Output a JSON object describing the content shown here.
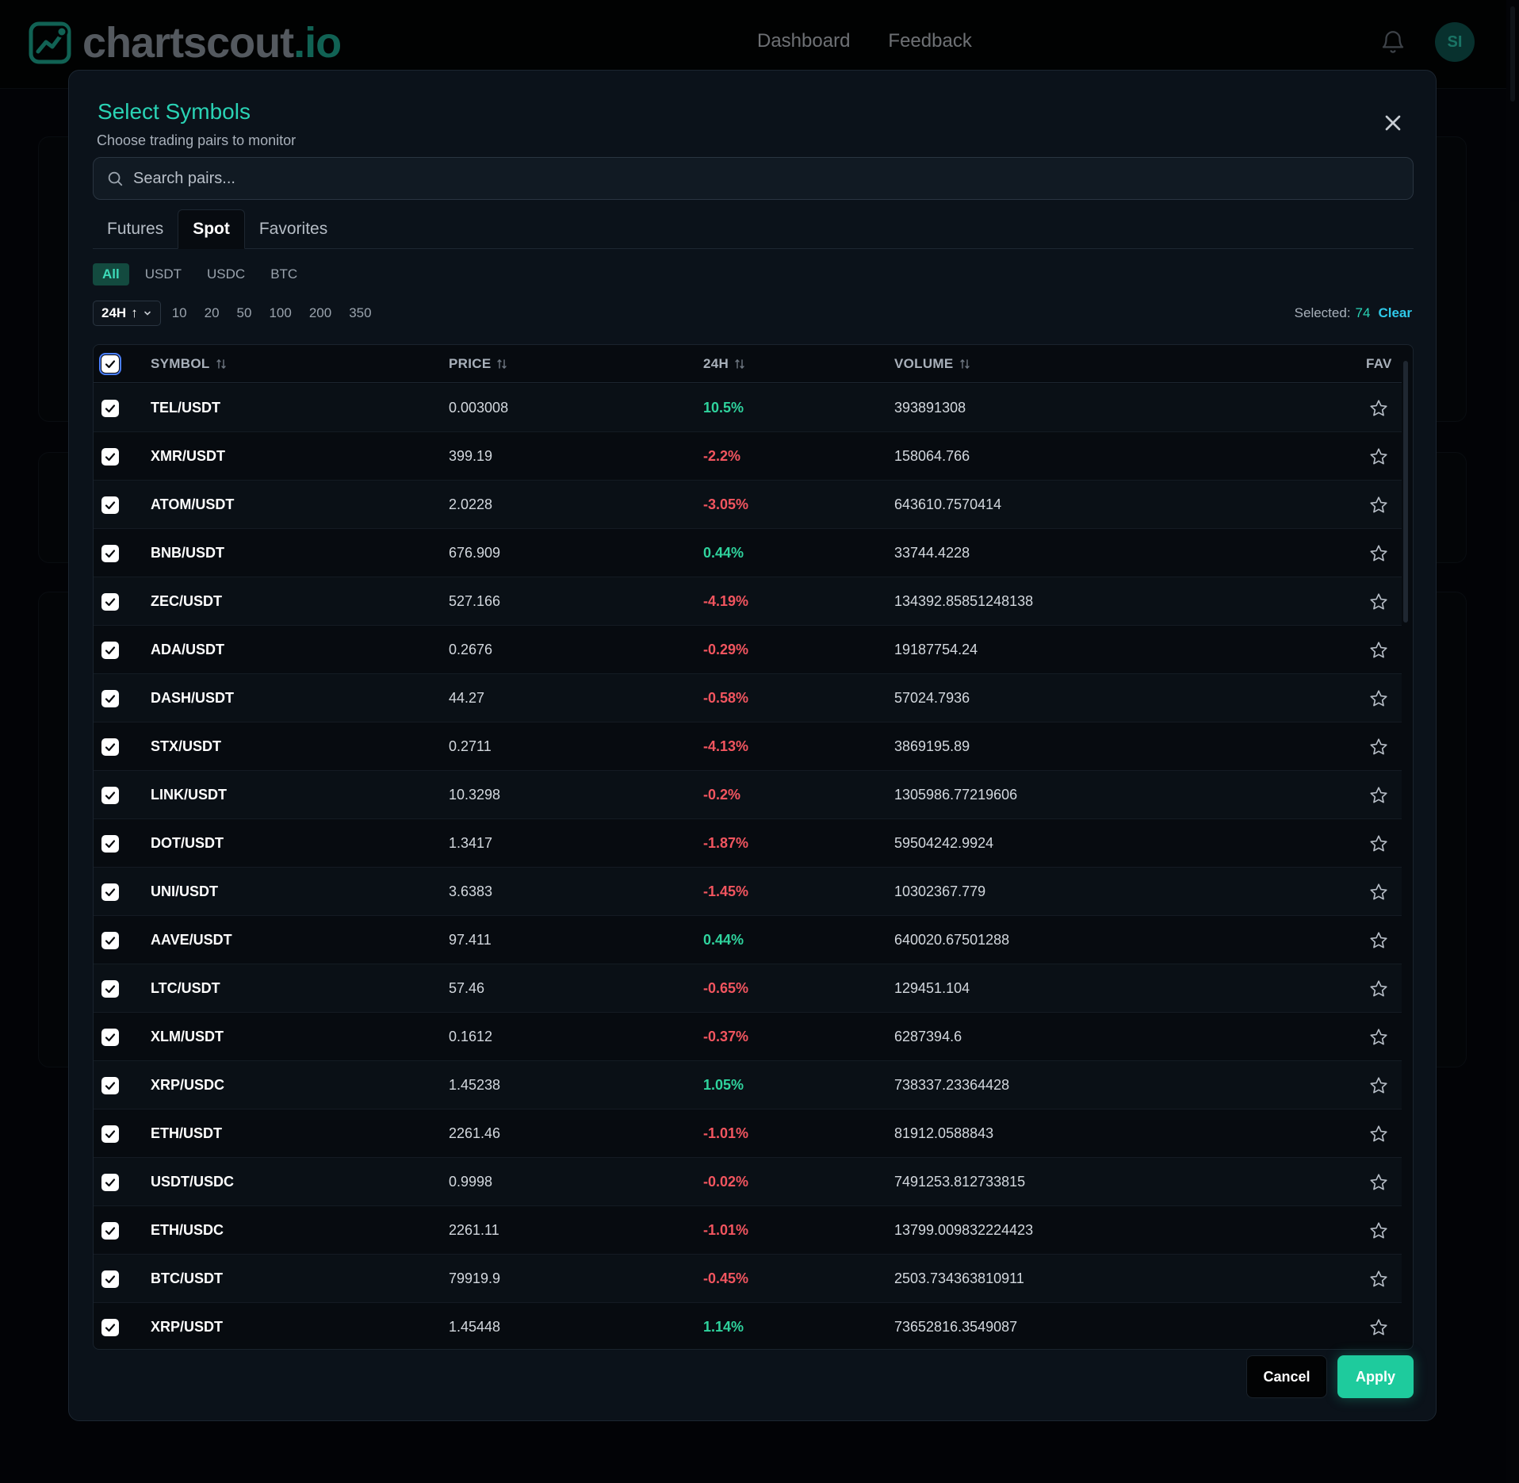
{
  "header": {
    "logo_main": "chartscout",
    "logo_accent": ".io",
    "nav": [
      "Dashboard",
      "Feedback"
    ],
    "avatar_initials": "SI"
  },
  "modal": {
    "title": "Select Symbols",
    "subtitle": "Choose trading pairs to monitor",
    "search_placeholder": "Search pairs...",
    "tabs": [
      "Futures",
      "Spot",
      "Favorites"
    ],
    "active_tab": "Spot",
    "quote_filters": [
      "All",
      "USDT",
      "USDC",
      "BTC"
    ],
    "active_quote": "All",
    "period_label": "24H",
    "limits": [
      "10",
      "20",
      "50",
      "100",
      "200",
      "350"
    ],
    "selected_label": "Selected:",
    "selected_count": "74",
    "clear_label": "Clear",
    "columns": [
      "SYMBOL",
      "PRICE",
      "24H",
      "VOLUME",
      "FAV"
    ],
    "rows": [
      {
        "symbol": "TEL/USDT",
        "price": "0.003008",
        "change": "10.5%",
        "dir": "up",
        "volume": "393891308"
      },
      {
        "symbol": "XMR/USDT",
        "price": "399.19",
        "change": "-2.2%",
        "dir": "down",
        "volume": "158064.766"
      },
      {
        "symbol": "ATOM/USDT",
        "price": "2.0228",
        "change": "-3.05%",
        "dir": "down",
        "volume": "643610.7570414"
      },
      {
        "symbol": "BNB/USDT",
        "price": "676.909",
        "change": "0.44%",
        "dir": "up",
        "volume": "33744.4228"
      },
      {
        "symbol": "ZEC/USDT",
        "price": "527.166",
        "change": "-4.19%",
        "dir": "down",
        "volume": "134392.85851248138"
      },
      {
        "symbol": "ADA/USDT",
        "price": "0.2676",
        "change": "-0.29%",
        "dir": "down",
        "volume": "19187754.24"
      },
      {
        "symbol": "DASH/USDT",
        "price": "44.27",
        "change": "-0.58%",
        "dir": "down",
        "volume": "57024.7936"
      },
      {
        "symbol": "STX/USDT",
        "price": "0.2711",
        "change": "-4.13%",
        "dir": "down",
        "volume": "3869195.89"
      },
      {
        "symbol": "LINK/USDT",
        "price": "10.3298",
        "change": "-0.2%",
        "dir": "down",
        "volume": "1305986.77219606"
      },
      {
        "symbol": "DOT/USDT",
        "price": "1.3417",
        "change": "-1.87%",
        "dir": "down",
        "volume": "59504242.9924"
      },
      {
        "symbol": "UNI/USDT",
        "price": "3.6383",
        "change": "-1.45%",
        "dir": "down",
        "volume": "10302367.779"
      },
      {
        "symbol": "AAVE/USDT",
        "price": "97.411",
        "change": "0.44%",
        "dir": "up",
        "volume": "640020.67501288"
      },
      {
        "symbol": "LTC/USDT",
        "price": "57.46",
        "change": "-0.65%",
        "dir": "down",
        "volume": "129451.104"
      },
      {
        "symbol": "XLM/USDT",
        "price": "0.1612",
        "change": "-0.37%",
        "dir": "down",
        "volume": "6287394.6"
      },
      {
        "symbol": "XRP/USDC",
        "price": "1.45238",
        "change": "1.05%",
        "dir": "up",
        "volume": "738337.23364428"
      },
      {
        "symbol": "ETH/USDT",
        "price": "2261.46",
        "change": "-1.01%",
        "dir": "down",
        "volume": "81912.0588843"
      },
      {
        "symbol": "USDT/USDC",
        "price": "0.9998",
        "change": "-0.02%",
        "dir": "down",
        "volume": "7491253.812733815"
      },
      {
        "symbol": "ETH/USDC",
        "price": "2261.11",
        "change": "-1.01%",
        "dir": "down",
        "volume": "13799.009832224423"
      },
      {
        "symbol": "BTC/USDT",
        "price": "79919.9",
        "change": "-0.45%",
        "dir": "down",
        "volume": "2503.734363810911"
      },
      {
        "symbol": "XRP/USDT",
        "price": "1.45448",
        "change": "1.14%",
        "dir": "up",
        "volume": "73652816.3549087"
      }
    ],
    "cancel_label": "Cancel",
    "apply_label": "Apply"
  },
  "colors": {
    "accent": "#2ad3b5",
    "positive": "#2fd39d",
    "negative": "#f2555f",
    "apply": "#1ecb9d",
    "clear_link": "#2fc9e9"
  },
  "icons": [
    "logo-chart-icon",
    "bell-icon",
    "close-icon",
    "search-icon",
    "chevron-down-icon",
    "sort-icon",
    "check-icon",
    "star-icon"
  ]
}
